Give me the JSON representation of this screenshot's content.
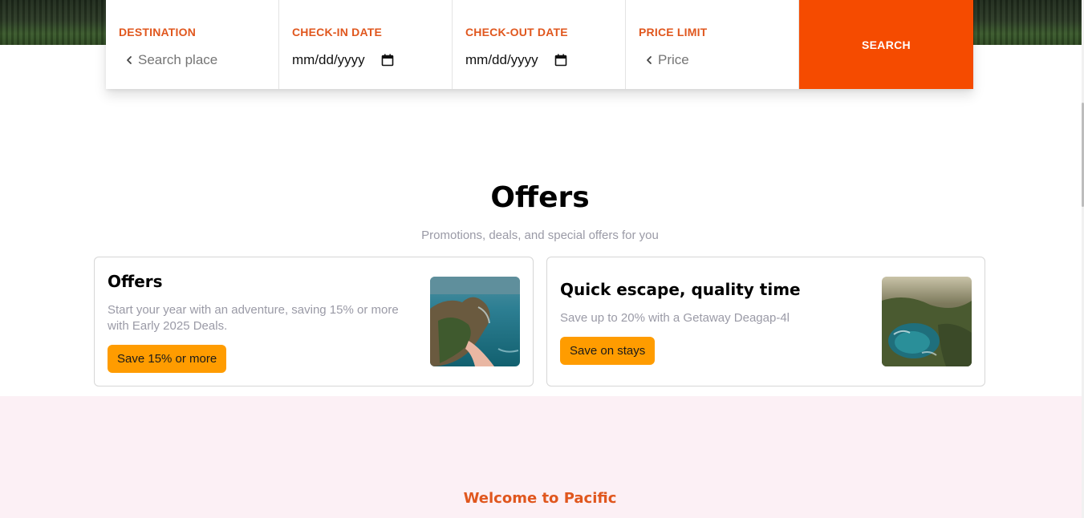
{
  "search_bar": {
    "destination": {
      "label": "DESTINATION",
      "placeholder": "Search place"
    },
    "check_in": {
      "label": "CHECK-IN DATE",
      "value": "mm/dd/yyyy"
    },
    "check_out": {
      "label": "CHECK-OUT DATE",
      "value": "mm/dd/yyyy"
    },
    "price_limit": {
      "label": "PRICE LIMIT",
      "placeholder": "Price"
    },
    "search_label": "SEARCH"
  },
  "offers": {
    "title": "Offers",
    "subtitle": "Promotions, deals, and special offers for you",
    "cards": [
      {
        "title": "Offers",
        "description": "Start your year with an adventure, saving 15% or more with Early 2025 Deals.",
        "button": "Save 15% or more",
        "image": "coastal-cliff-beach-photo"
      },
      {
        "title": "Quick escape, quality time",
        "description": "Save up to 20% with a Getaway Deagap-4l",
        "button": "Save on stays",
        "image": "island-bay-aerial-photo"
      }
    ]
  },
  "welcome": {
    "title": "Welcome to Pacific"
  },
  "colors": {
    "accent_orange": "#e0571e",
    "search_button": "#f54b00",
    "card_button": "#ff9c00",
    "welcome_bg": "#fcf0f5"
  }
}
